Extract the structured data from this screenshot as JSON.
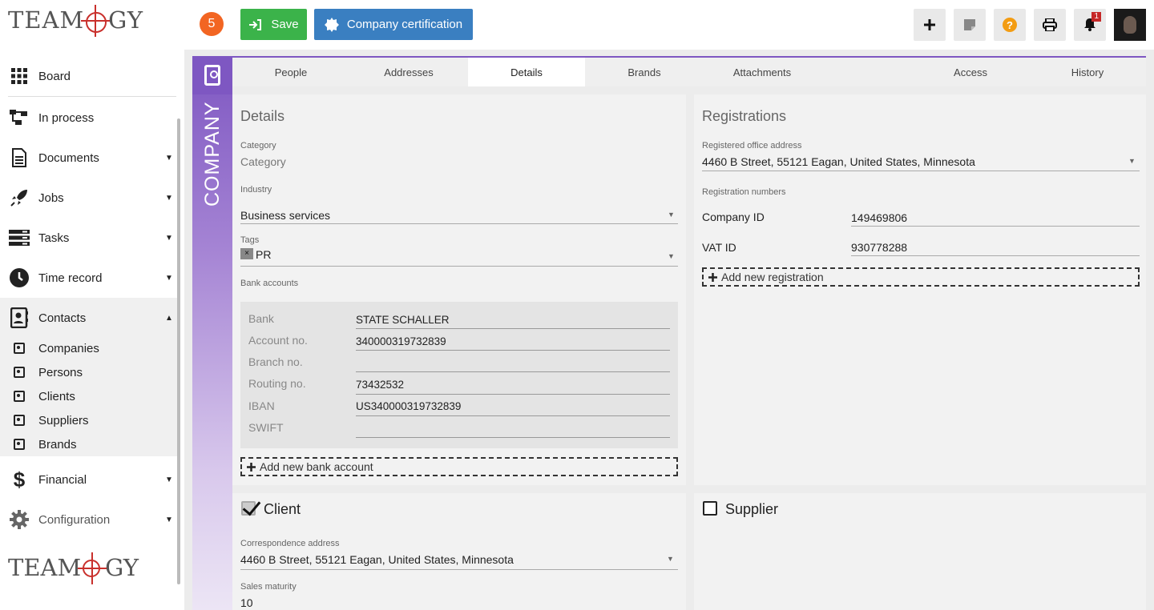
{
  "brand": {
    "logo_text": "TEAMOGY"
  },
  "header": {
    "counter": "5",
    "save_label": "Save",
    "cert_label": "Company certification",
    "notification_count": "1"
  },
  "sidebar": {
    "items": [
      {
        "label": "Board",
        "icon": "grid-icon"
      },
      {
        "label": "In process",
        "icon": "flow-icon"
      },
      {
        "label": "Documents",
        "icon": "document-icon"
      },
      {
        "label": "Jobs",
        "icon": "rocket-icon"
      },
      {
        "label": "Tasks",
        "icon": "tasks-icon"
      },
      {
        "label": "Time record",
        "icon": "clock-icon"
      },
      {
        "label": "Contacts",
        "icon": "contacts-icon"
      },
      {
        "label": "Financial",
        "icon": "dollar-icon"
      },
      {
        "label": "Configuration",
        "icon": "gear-icon"
      }
    ],
    "contacts_sub": [
      "Companies",
      "Persons",
      "Clients",
      "Suppliers",
      "Brands"
    ]
  },
  "entity_label": "COMPANY",
  "tabs": [
    "People",
    "Addresses",
    "Details",
    "Brands",
    "Attachments",
    "Access",
    "History"
  ],
  "active_tab": "Details",
  "details": {
    "title": "Details",
    "category_label": "Category",
    "category_placeholder": "Category",
    "industry_label": "Industry",
    "industry_value": "Business services",
    "tags_label": "Tags",
    "tag_value": "PR",
    "tag_remove": "×",
    "bank_accounts_label": "Bank accounts",
    "bank": {
      "bank_label": "Bank",
      "bank_value": "STATE SCHALLER",
      "account_label": "Account no.",
      "account_value": "340000319732839",
      "branch_label": "Branch no.",
      "branch_value": "",
      "routing_label": "Routing no.",
      "routing_value": "73432532",
      "iban_label": "IBAN",
      "iban_value": "US340000319732839",
      "swift_label": "SWIFT",
      "swift_value": ""
    },
    "add_bank_label": "Add new bank account"
  },
  "registrations": {
    "title": "Registrations",
    "office_label": "Registered office address",
    "office_value": "4460 B Street, 55121 Eagan, United States, Minnesota",
    "numbers_label": "Registration numbers",
    "company_id_label": "Company ID",
    "company_id_value": "149469806",
    "vat_id_label": "VAT ID",
    "vat_id_value": "930778288",
    "add_label": "Add new registration"
  },
  "client": {
    "label": "Client",
    "checked": true,
    "corr_label": "Correspondence address",
    "corr_value": "4460 B Street, 55121 Eagan, United States, Minnesota",
    "maturity_label": "Sales maturity",
    "maturity_value": "10"
  },
  "supplier": {
    "label": "Supplier",
    "checked": false
  },
  "colors": {
    "accent": "#7e57c2",
    "save": "#3bb34a",
    "cert": "#3a7fc1",
    "counter": "#f26522"
  }
}
